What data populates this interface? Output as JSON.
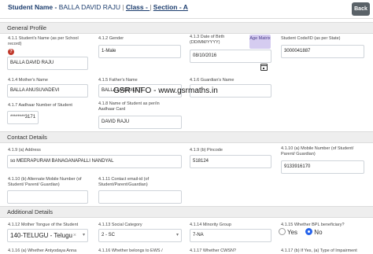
{
  "header": {
    "student_label": "Student Name -",
    "student_name": "BALLA DAVID RAJU",
    "sep": "|",
    "class_link": "Class - ",
    "section_link": "Section - A",
    "back_label": "Back"
  },
  "sections": {
    "general": "General Profile",
    "contact": "Contact Details",
    "additional": "Additional Details"
  },
  "general": {
    "student_name_label": "4.1.1 Student's Name (as per School",
    "student_name_label2": "record)",
    "student_name_value": "BALLA DAVID RAJU",
    "gender_label": "4.1.2 Gender",
    "gender_value": "1-Male",
    "dob_label": "4.1.3 Date of Birth",
    "dob_label2": "(DD/MM/YYYY)",
    "dob_value": "08/10/2016",
    "age_matrix_label": "Age Matrix",
    "student_code_label": "Student Code/ID (as per State)",
    "student_code_value": "3000041887",
    "mother_label": "4.1.4 Mother's Name",
    "mother_value": "BALLA ANUSUVADEVI",
    "father_label": "4.1.5 Father's Name",
    "father_value": "BALLA MADDILETI",
    "guardian_label": "4.1.6 Guardian's Name",
    "guardian_value": "",
    "aadhaar_label": "4.1.7 Aadhaar Number of Student",
    "aadhaar_value": "********3171",
    "aadhaar_name_label": "4.1.8 Name of Student as per/in",
    "aadhaar_name_label2": "Aadhaar Card",
    "aadhaar_name_value": "DAVID RAJU"
  },
  "contact": {
    "address_label": "4.1.9 (a) Address",
    "address_value": "so MEERAPURAM BANAGANAPALLI NANDYAL",
    "pincode_label": "4.1.9 (b) Pincode",
    "pincode_value": "518124",
    "mobile_label": "4.1.10 (a) Mobile Number (of Student/",
    "mobile_label2": "Parent/ Guardian)",
    "mobile_value": "9133916170",
    "alt_mobile_label": "4.1.10 (b) Alternate Mobile Number (of",
    "alt_mobile_label2": "Student/ Parent/ Guardian)",
    "alt_mobile_value": "",
    "email_label": "4.1.11 Contact email-id (of",
    "email_label2": "Student/Parent/Guardian)",
    "email_value": ""
  },
  "additional": {
    "mother_tongue_label": "4.1.12 Mother Tongue of the Student",
    "mother_tongue_value": "140-TELUGU - Telugu",
    "category_label": "4.1.13 Social Category",
    "category_value": "2 - SC",
    "minority_label": "4.1.14 Minority Group",
    "minority_value": "7-NA",
    "bpl_label": "4.1.15 Whether BPL beneficiary?",
    "bpl_yes": "Yes",
    "bpl_no": "No",
    "q16a_label": "4.1.16 (a) Whether Antyodaya Anna",
    "q16_label": "4.1.16 Whether belongs to EWS /",
    "q17_label": "4.1.17 Whether CWSN?",
    "q17b_label": "4.1.17 (b) If Yes, (a) Type of Impairment"
  },
  "watermark": "GSR INFO - www.gsrmaths.in"
}
